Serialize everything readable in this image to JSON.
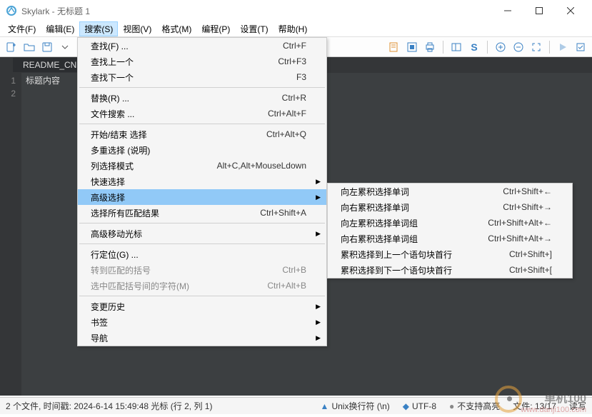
{
  "title": "Skylark - 无标题 1",
  "menubar": [
    "文件(F)",
    "编辑(E)",
    "搜索(S)",
    "视图(V)",
    "格式(M)",
    "编程(P)",
    "设置(T)",
    "帮助(H)"
  ],
  "tab": {
    "name": "README_CN.M",
    "close": "×"
  },
  "gutter": [
    "1",
    "2"
  ],
  "code_line1": "标题内容",
  "status": {
    "left": "2 个文件, 时间戳: 2024-6-14 15:49:48 光标 (行 2, 列 1)",
    "eol_icon": "▲",
    "eol": "Unix换行符 (\\n)",
    "enc_icon": "◆",
    "enc": "UTF-8",
    "hl_icon": "●",
    "hl": "不支持高亮",
    "pos": "文件: 13/17",
    "rw": "读写"
  },
  "search_menu": [
    {
      "label": "查找(F) ...",
      "shortcut": "Ctrl+F"
    },
    {
      "label": "查找上一个",
      "shortcut": "Ctrl+F3"
    },
    {
      "label": "查找下一个",
      "shortcut": "F3"
    },
    {
      "sep": true
    },
    {
      "label": "替换(R) ...",
      "shortcut": "Ctrl+R"
    },
    {
      "label": "文件搜索 ...",
      "shortcut": "Ctrl+Alt+F"
    },
    {
      "sep": true
    },
    {
      "label": "开始/结束 选择",
      "shortcut": "Ctrl+Alt+Q"
    },
    {
      "label": "多重选择 (说明)",
      "shortcut": ""
    },
    {
      "label": "列选择模式",
      "shortcut": "Alt+C,Alt+MouseLdown"
    },
    {
      "label": "快速选择",
      "sub": true
    },
    {
      "label": "高级选择",
      "sub": true,
      "hl": true
    },
    {
      "label": "选择所有匹配结果",
      "shortcut": "Ctrl+Shift+A"
    },
    {
      "sep": true
    },
    {
      "label": "高级移动光标",
      "sub": true
    },
    {
      "sep": true
    },
    {
      "label": "行定位(G) ...",
      "shortcut": ""
    },
    {
      "label": "转到匹配的括号",
      "shortcut": "Ctrl+B",
      "disabled": true
    },
    {
      "label": "选中匹配括号间的字符(M)",
      "shortcut": "Ctrl+Alt+B",
      "disabled": true
    },
    {
      "sep": true
    },
    {
      "label": "变更历史",
      "sub": true
    },
    {
      "label": "书签",
      "sub": true
    },
    {
      "label": "导航",
      "sub": true
    }
  ],
  "submenu": [
    {
      "label": "向左累积选择单词",
      "shortcut": "Ctrl+Shift+←"
    },
    {
      "label": "向右累积选择单词",
      "shortcut": "Ctrl+Shift+→"
    },
    {
      "label": "向左累积选择单词组",
      "shortcut": "Ctrl+Shift+Alt+←"
    },
    {
      "label": "向右累积选择单词组",
      "shortcut": "Ctrl+Shift+Alt+→"
    },
    {
      "label": "累积选择到上一个语句块首行",
      "shortcut": "Ctrl+Shift+]"
    },
    {
      "label": "累积选择到下一个语句块首行",
      "shortcut": "Ctrl+Shift+["
    }
  ],
  "watermark": {
    "t1": "单机100",
    "t2": "www.danji100.com"
  }
}
